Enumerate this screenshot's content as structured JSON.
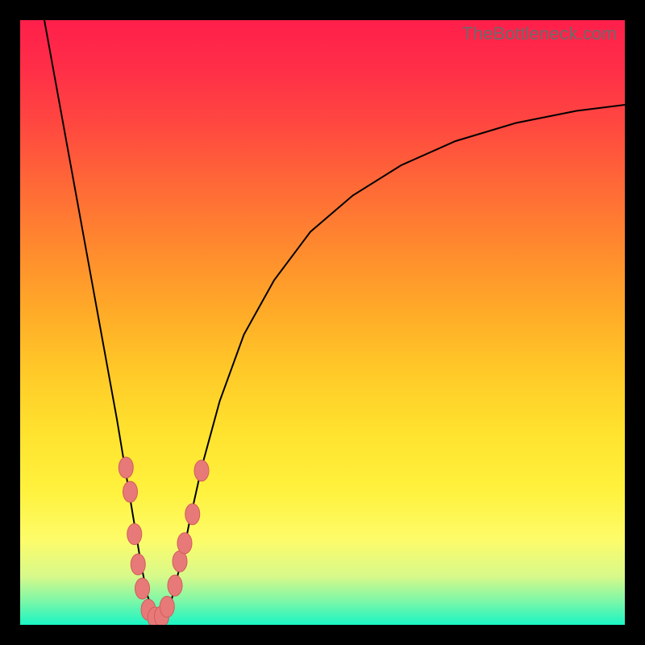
{
  "watermark": "TheBottleneck.com",
  "colors": {
    "background": "#000000",
    "curve": "#000000",
    "bead_fill": "#e77a78",
    "bead_stroke": "#d25c5c"
  },
  "chart_data": {
    "type": "line",
    "title": "",
    "xlabel": "",
    "ylabel": "",
    "xlim": [
      0,
      100
    ],
    "ylim": [
      0,
      100
    ],
    "series": [
      {
        "name": "bottleneck-curve",
        "x": [
          4,
          6,
          8,
          10,
          12,
          14,
          16,
          17,
          18,
          19,
          20,
          21,
          22,
          23,
          24,
          25,
          26,
          27,
          28,
          30,
          33,
          37,
          42,
          48,
          55,
          63,
          72,
          82,
          92,
          100
        ],
        "y": [
          100,
          89,
          78,
          67,
          56,
          45,
          34,
          28,
          22,
          16,
          10,
          5,
          2,
          1,
          2,
          4,
          8,
          12,
          17,
          26,
          37,
          48,
          57,
          65,
          71,
          76,
          80,
          83,
          85,
          86
        ]
      }
    ],
    "beads": {
      "name": "highlighted-cluster",
      "points": [
        {
          "x": 17.5,
          "y": 26
        },
        {
          "x": 18.2,
          "y": 22
        },
        {
          "x": 18.9,
          "y": 15
        },
        {
          "x": 19.5,
          "y": 10
        },
        {
          "x": 20.2,
          "y": 6
        },
        {
          "x": 21.2,
          "y": 2.5
        },
        {
          "x": 22.3,
          "y": 1.2
        },
        {
          "x": 23.4,
          "y": 1.4
        },
        {
          "x": 24.3,
          "y": 3.0
        },
        {
          "x": 25.6,
          "y": 6.5
        },
        {
          "x": 26.4,
          "y": 10.5
        },
        {
          "x": 27.2,
          "y": 13.5
        },
        {
          "x": 28.5,
          "y": 18.3
        },
        {
          "x": 30.0,
          "y": 25.5
        }
      ]
    }
  }
}
